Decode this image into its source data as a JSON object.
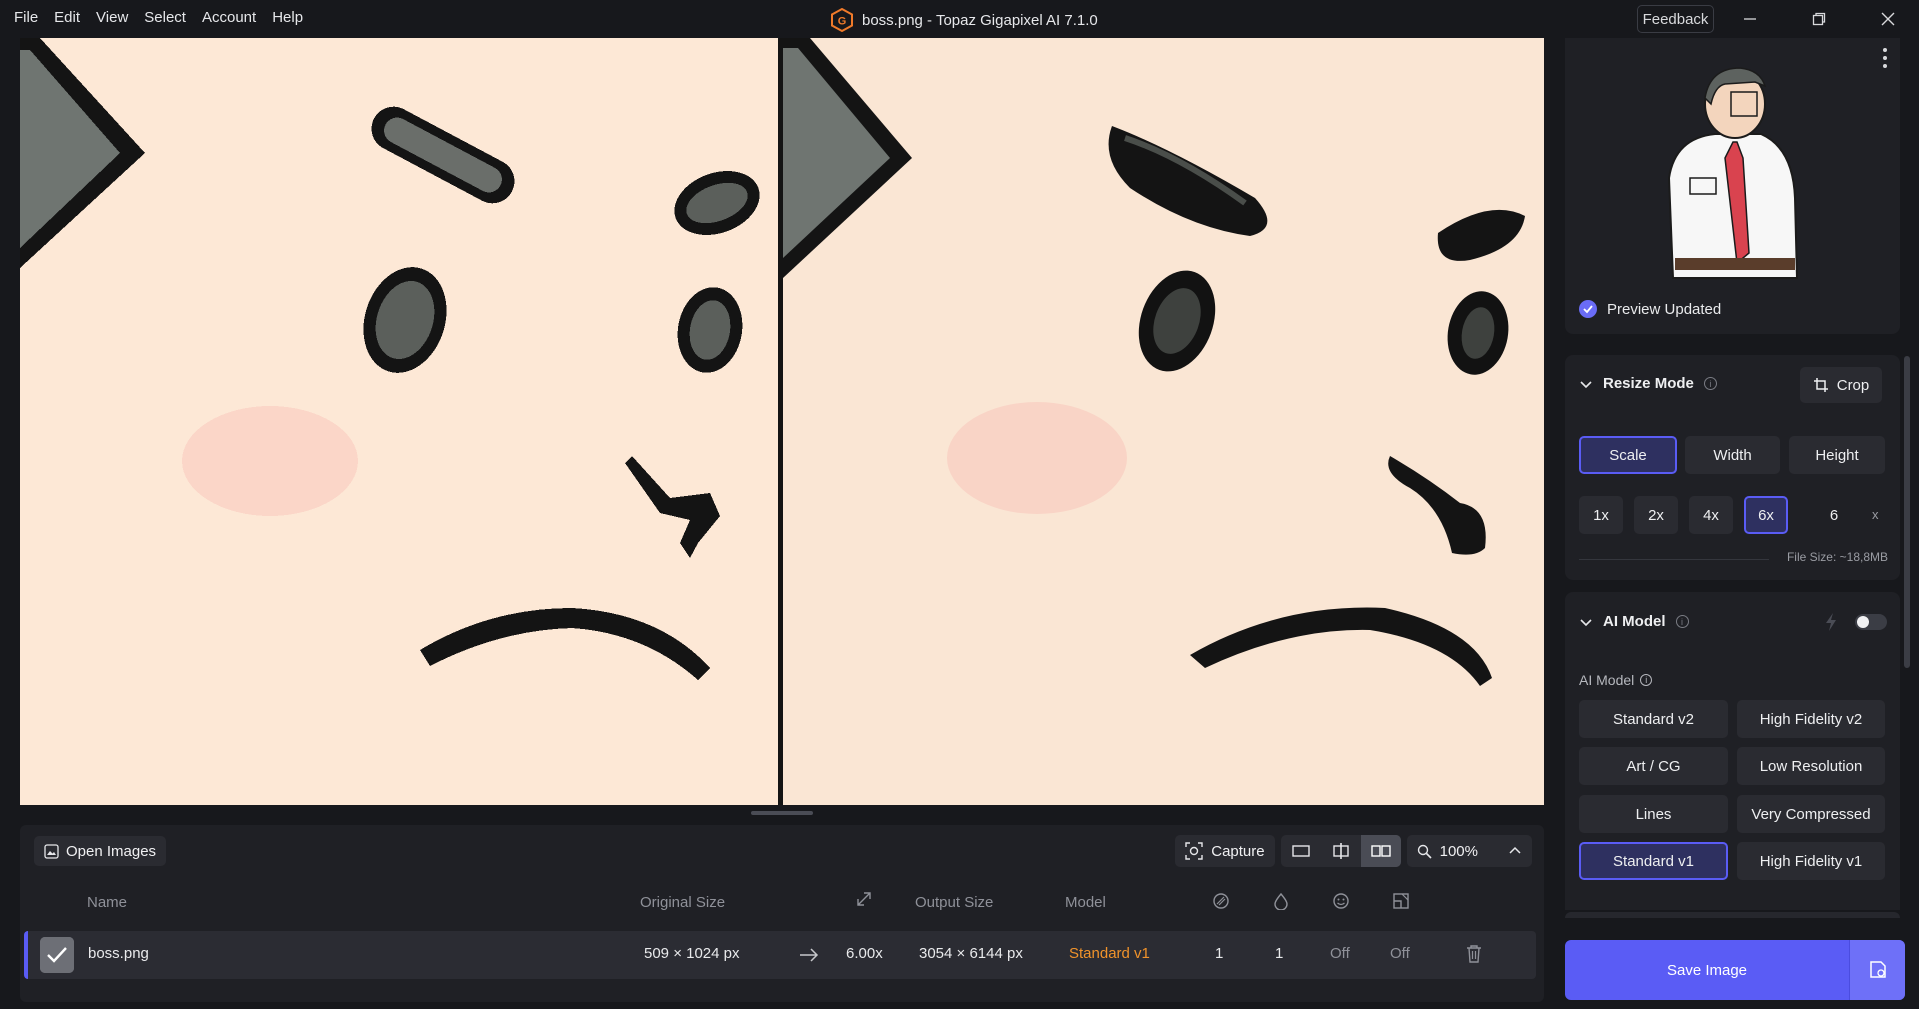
{
  "menu": [
    "File",
    "Edit",
    "View",
    "Select",
    "Account",
    "Help"
  ],
  "window": {
    "title": "boss.png - Topaz Gigapixel AI 7.1.0",
    "feedback_label": "Feedback",
    "logo_letter": "G"
  },
  "bottom_panel": {
    "open_images_label": "Open Images",
    "capture_label": "Capture",
    "zoom_level": "100%",
    "columns": {
      "name": "Name",
      "original_size": "Original Size",
      "output_size": "Output Size",
      "model": "Model"
    },
    "row": {
      "name": "boss.png",
      "original_size": "509 × 1024 px",
      "scale": "6.00x",
      "output_size": "3054 × 6144 px",
      "model": "Standard v1",
      "col1": "1",
      "col2": "1",
      "col3": "Off",
      "col4": "Off"
    }
  },
  "right_panel": {
    "preview_status": "Preview Updated",
    "resize_mode": {
      "title": "Resize Mode",
      "crop_label": "Crop",
      "modes": [
        "Scale",
        "Width",
        "Height"
      ],
      "selected_mode": "Scale",
      "scales": [
        "1x",
        "2x",
        "4x",
        "6x"
      ],
      "selected_scale": "6x",
      "custom_scale_value": "6",
      "custom_scale_suffix": "x",
      "file_size": "File Size: ~18,8MB"
    },
    "ai_model": {
      "title": "AI Model",
      "sublabel": "AI Model",
      "enabled": false,
      "models": [
        "Standard v2",
        "High Fidelity v2",
        "Art / CG",
        "Low Resolution",
        "Lines",
        "Very Compressed",
        "Standard v1",
        "High Fidelity v1"
      ],
      "selected_model": "Standard v1"
    },
    "save_label": "Save Image"
  },
  "colors": {
    "accent": "#5a5cf5",
    "model_highlight": "#f0932b",
    "skin": "#fde8d6"
  }
}
